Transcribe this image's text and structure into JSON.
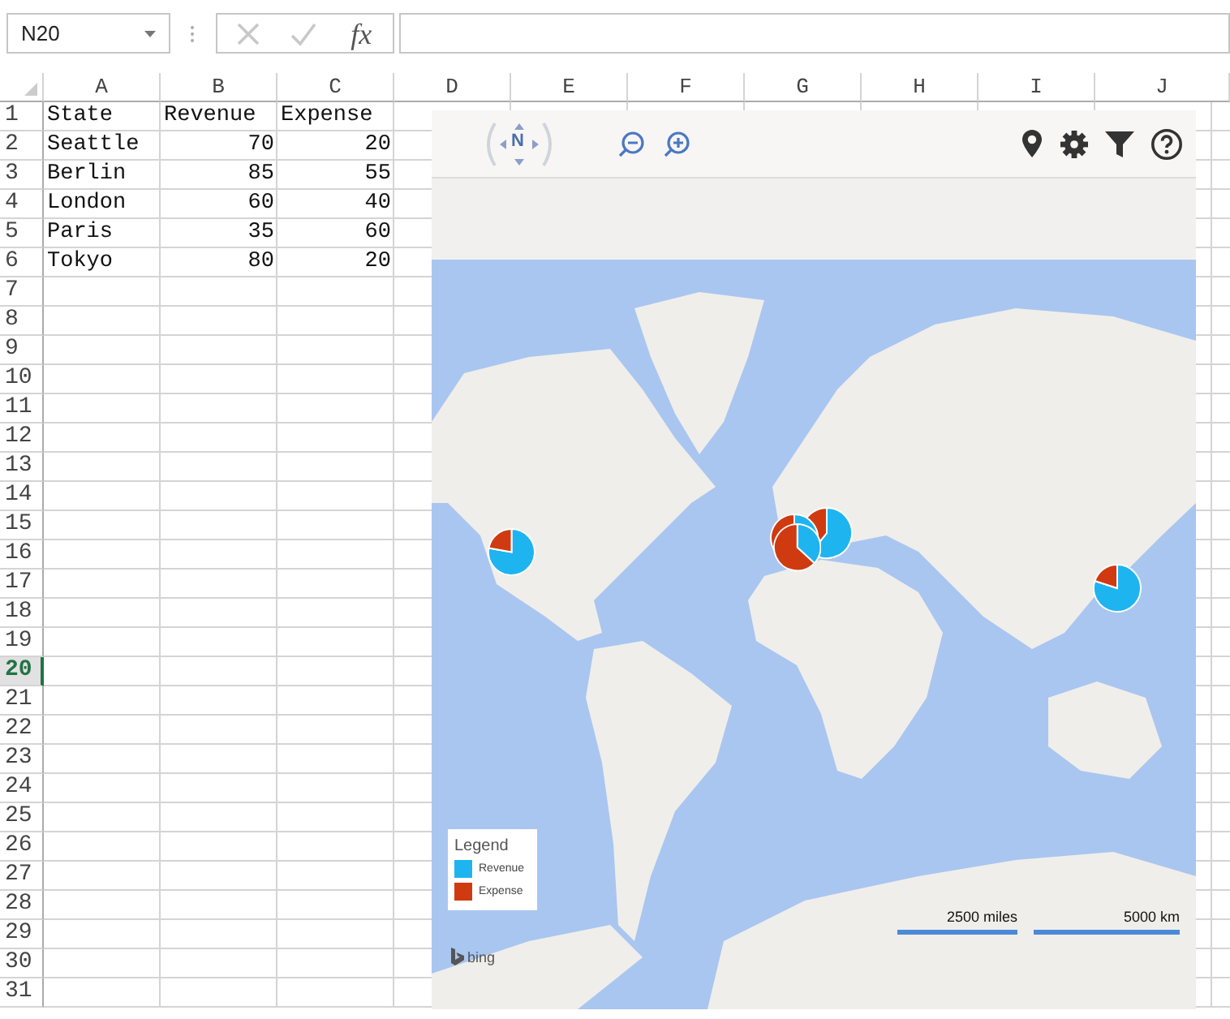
{
  "formula_bar": {
    "name_box": "N20",
    "function_label": "fx"
  },
  "sheet": {
    "columns": [
      {
        "label": "A",
        "selected": false
      },
      {
        "label": "B",
        "selected": false
      },
      {
        "label": "C",
        "selected": false
      },
      {
        "label": "D",
        "selected": false
      },
      {
        "label": "E",
        "selected": false
      },
      {
        "label": "F",
        "selected": false
      },
      {
        "label": "G",
        "selected": false
      },
      {
        "label": "H",
        "selected": false
      },
      {
        "label": "I",
        "selected": false
      },
      {
        "label": "J",
        "selected": false
      }
    ],
    "rows": [
      {
        "number": "1",
        "selected": false,
        "cells": [
          "State",
          "Revenue",
          "Expense"
        ]
      },
      {
        "number": "2",
        "selected": false,
        "cells": [
          "Seattle",
          "70",
          "20"
        ]
      },
      {
        "number": "3",
        "selected": false,
        "cells": [
          "Berlin",
          "85",
          "55"
        ]
      },
      {
        "number": "4",
        "selected": false,
        "cells": [
          "London",
          "60",
          "40"
        ]
      },
      {
        "number": "5",
        "selected": false,
        "cells": [
          "Paris",
          "35",
          "60"
        ]
      },
      {
        "number": "6",
        "selected": false,
        "cells": [
          "Tokyo",
          "80",
          "20"
        ]
      },
      {
        "number": "7",
        "selected": false
      },
      {
        "number": "8",
        "selected": false
      },
      {
        "number": "9",
        "selected": false
      },
      {
        "number": "10",
        "selected": false
      },
      {
        "number": "11",
        "selected": false
      },
      {
        "number": "12",
        "selected": false
      },
      {
        "number": "13",
        "selected": false
      },
      {
        "number": "14",
        "selected": false
      },
      {
        "number": "15",
        "selected": false
      },
      {
        "number": "16",
        "selected": false
      },
      {
        "number": "17",
        "selected": false
      },
      {
        "number": "18",
        "selected": false
      },
      {
        "number": "19",
        "selected": false
      },
      {
        "number": "20",
        "selected": true
      },
      {
        "number": "21",
        "selected": false
      },
      {
        "number": "22",
        "selected": false
      },
      {
        "number": "23",
        "selected": false
      },
      {
        "number": "24",
        "selected": false
      },
      {
        "number": "25",
        "selected": false
      },
      {
        "number": "26",
        "selected": false
      },
      {
        "number": "27",
        "selected": false
      },
      {
        "number": "28",
        "selected": false
      },
      {
        "number": "29",
        "selected": false
      },
      {
        "number": "30",
        "selected": false
      },
      {
        "number": "31",
        "selected": false
      }
    ]
  },
  "map": {
    "toolbar": {
      "compass_label": "N"
    },
    "legend": {
      "title": "Legend",
      "series": [
        {
          "name": "Revenue",
          "color": "#1eb4f0"
        },
        {
          "name": "Expense",
          "color": "#d03a10"
        }
      ]
    },
    "scale": [
      "2500 miles",
      "5000 km"
    ],
    "attribution": "bing"
  }
}
